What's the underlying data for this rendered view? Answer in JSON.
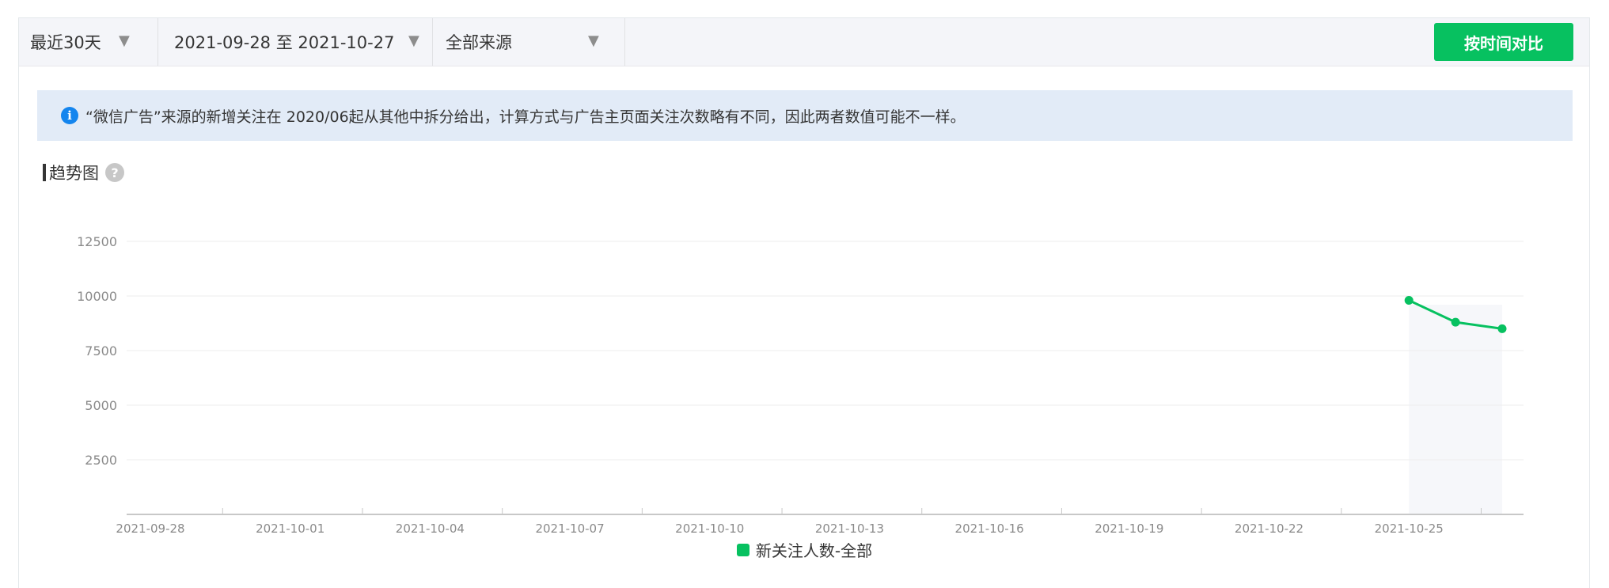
{
  "toolbar": {
    "range_label": "最近30天",
    "date_range": "2021-09-28 至 2021-10-27",
    "source_label": "全部来源",
    "compare_button": "按时间对比"
  },
  "notice": {
    "text": "“微信广告”来源的新增关注在 2020/06起从其他中拆分给出，计算方式与广告主页面关注次数略有不同，因此两者数值可能不一样。"
  },
  "section": {
    "title": "趋势图"
  },
  "colors": {
    "accent": "#07c160",
    "info": "#1485ee"
  },
  "chart_data": {
    "type": "line",
    "title": "",
    "xlabel": "",
    "ylabel": "",
    "ylim": [
      0,
      12500
    ],
    "yticks": [
      2500,
      5000,
      7500,
      10000,
      12500
    ],
    "xlim": [
      "2021-09-28",
      "2021-10-27"
    ],
    "xticks": [
      "2021-09-28",
      "2021-10-01",
      "2021-10-04",
      "2021-10-07",
      "2021-10-10",
      "2021-10-13",
      "2021-10-16",
      "2021-10-19",
      "2021-10-22",
      "2021-10-25"
    ],
    "grid": true,
    "legend": "bottom-center",
    "series": [
      {
        "name": "新关注人数-全部",
        "color": "#07c160",
        "x": [
          "2021-10-25",
          "2021-10-26",
          "2021-10-27"
        ],
        "values": [
          9800,
          8800,
          8500
        ]
      }
    ]
  }
}
